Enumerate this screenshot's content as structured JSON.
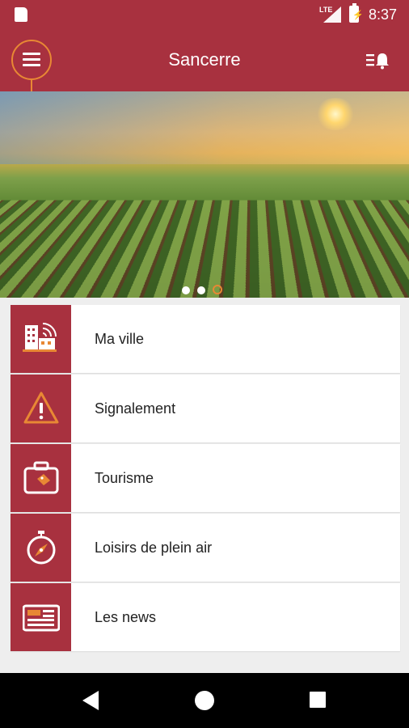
{
  "status_bar": {
    "network": "LTE",
    "time": "8:37",
    "icons": [
      "sd-card-icon",
      "signal-icon",
      "battery-charging-icon"
    ]
  },
  "app_bar": {
    "title": "Sancerre",
    "menu_icon": "hamburger-menu-icon",
    "notifications_icon": "notification-list-bell-icon"
  },
  "hero": {
    "image": "vineyard-sunrise-photo",
    "carousel_dots": 3,
    "active_dot": 3
  },
  "menu": {
    "items": [
      {
        "label": "Ma ville",
        "icon": "city-wifi-icon"
      },
      {
        "label": "Signalement",
        "icon": "warning-triangle-icon"
      },
      {
        "label": "Tourisme",
        "icon": "suitcase-icon"
      },
      {
        "label": "Loisirs de plein air",
        "icon": "stopwatch-compass-icon"
      },
      {
        "label": "Les news",
        "icon": "newspaper-icon"
      }
    ]
  },
  "colors": {
    "primary": "#a8313f",
    "accent": "#e88834"
  }
}
